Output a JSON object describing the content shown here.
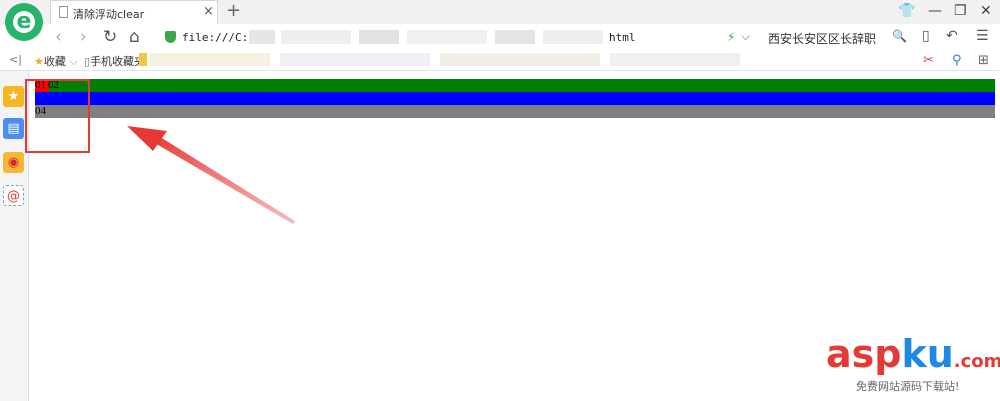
{
  "tab": {
    "title": "清除浮动clear",
    "close": "×",
    "new_tab": "+"
  },
  "window": {
    "skin": "👕",
    "minimize": "—",
    "restore": "❐",
    "close": "✕"
  },
  "nav": {
    "back": "‹",
    "forward": "›",
    "refresh": "↻",
    "home": "⌂"
  },
  "address": {
    "prefix": "file:///C:",
    "suffix": "html"
  },
  "search": {
    "text": "西安长安区区长辞职",
    "icon": "🔍"
  },
  "toolbar_icons": {
    "phone": "▯",
    "undo": "↶",
    "menu": "☰"
  },
  "bookmarks": {
    "collapse": "<|",
    "favorites": "收藏",
    "mobile": "手机收藏夹"
  },
  "sidebar": {
    "star": "★",
    "list": "▤",
    "weibo": "◉",
    "mail": "@"
  },
  "page": {
    "label_01": "01",
    "label_02": "02",
    "label_04": "04",
    "colors": {
      "green": "#008000",
      "blue": "#0000ff",
      "gray": "#808080",
      "red": "#ff0000"
    }
  },
  "watermark": {
    "brand_a": "asp",
    "brand_b": "ku",
    "brand_c": ".com",
    "tagline": "免费网站源码下载站!"
  }
}
